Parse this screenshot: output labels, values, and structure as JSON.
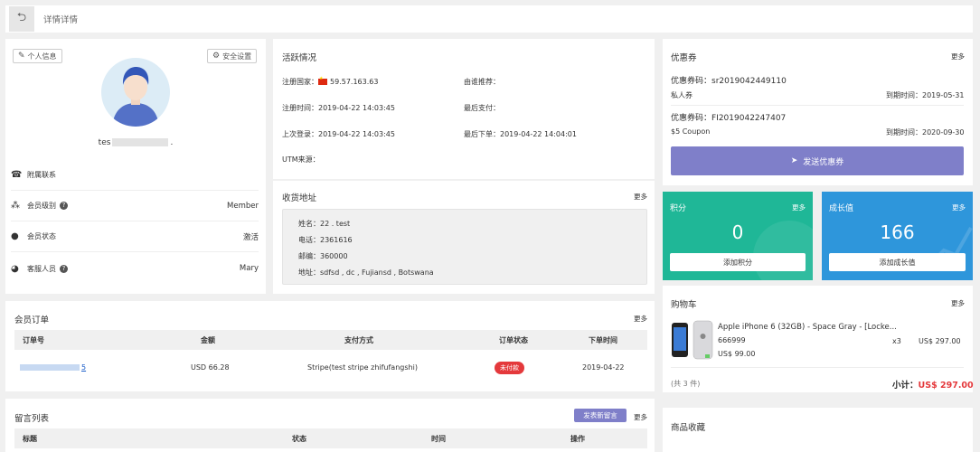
{
  "header": {
    "back_icon": "undo-icon",
    "title": "详情详情"
  },
  "profile": {
    "personal_info_button": "个人信息",
    "security_settings_button": "安全设置",
    "username_prefix": "tes",
    "username_suffix": ".",
    "rows": [
      {
        "icon": "phone-icon",
        "label": "附属联系",
        "value": ""
      },
      {
        "icon": "sitemap-icon",
        "label": "会员级别",
        "value": "Member",
        "help": "?"
      },
      {
        "icon": "user-lock-icon",
        "label": "会员状态",
        "value": "激活"
      },
      {
        "icon": "support-agent-icon",
        "label": "客服人员",
        "value": "Mary",
        "help": "?"
      }
    ]
  },
  "activity": {
    "title": "活跃情况",
    "register_country_label": "注册国家：",
    "register_country_value": "59.57.163.63",
    "referral_label": "由谁推荐：",
    "register_time_label": "注册时间：",
    "register_time_value": "2019-04-22 14:03:45",
    "last_payment_label": "最后支付：",
    "last_login_label": "上次登录：",
    "last_login_value": "2019-04-22 14:03:45",
    "last_order_label": "最后下单：",
    "last_order_value": "2019-04-22 14:04:01",
    "utm_label": "UTM来源："
  },
  "address": {
    "title": "收货地址",
    "more": "更多",
    "name_line": "姓名：22 . test",
    "phone_line": "电话：2361616",
    "zip_line": "邮编：360000",
    "addr_line": "地址：sdfsd , dc , Fujiansd , Botswana"
  },
  "coupons": {
    "title": "优惠券",
    "more": "更多",
    "items": [
      {
        "code": "优惠券码：sr2019042449110",
        "desc": "私人券",
        "expire": "到期时间：2019-05-31"
      },
      {
        "code": "优惠券码：FI2019042247407",
        "desc": "$5 Coupon",
        "expire": "到期时间：2020-09-30"
      }
    ],
    "send_button": "发送优惠券",
    "send_icon": "paper-plane-icon"
  },
  "points": {
    "title": "积分",
    "more": "更多",
    "value": "0",
    "button": "添加积分",
    "color": "#1fb797"
  },
  "growth": {
    "title": "成长值",
    "more": "更多",
    "value": "166",
    "button": "添加成长值",
    "color": "#2e96db"
  },
  "orders": {
    "title": "会员订单",
    "more": "更多",
    "headers": [
      "订单号",
      "金额",
      "支付方式",
      "订单状态",
      "下单时间"
    ],
    "row": {
      "order_no_suffix": "5",
      "amount": "USD 66.28",
      "payment": "Stripe(test stripe zhifufangshi)",
      "status": "未付款",
      "date": "2019-04-22"
    }
  },
  "cart": {
    "title": "购物车",
    "more": "更多",
    "item_name": "Apple iPhone 6 (32GB) - Space Gray - [Locke...",
    "item_sku": "666999",
    "item_price": "US$ 99.00",
    "item_qty": "x3",
    "item_total": "US$ 297.00",
    "count_text": "(共 3 件)",
    "subtotal_label": "小计：",
    "subtotal_value": "US$ 297.00"
  },
  "messages": {
    "title": "留言列表",
    "new_button": "发表新留言",
    "more": "更多",
    "headers": [
      "标题",
      "状态",
      "时间",
      "操作"
    ]
  },
  "favorites": {
    "title": "商品收藏"
  }
}
